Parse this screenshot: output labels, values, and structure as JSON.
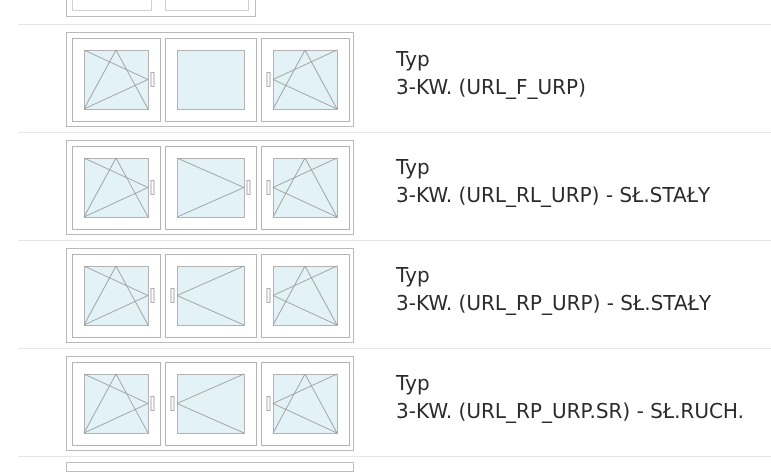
{
  "rows": [
    {
      "type_label": "Typ",
      "type_value": "3-KW. (URL_F_URP)",
      "panes": [
        "tilt-turn-right",
        "fixed",
        "tilt-turn-left"
      ]
    },
    {
      "type_label": "Typ",
      "type_value": "3-KW. (URL_RL_URP) - SŁ.STAŁY",
      "panes": [
        "tilt-turn-right",
        "turn-left",
        "tilt-turn-left"
      ]
    },
    {
      "type_label": "Typ",
      "type_value": "3-KW. (URL_RP_URP) - SŁ.STAŁY",
      "panes": [
        "tilt-turn-right",
        "turn-right",
        "tilt-turn-left"
      ]
    },
    {
      "type_label": "Typ",
      "type_value": "3-KW. (URL_RP_URP.SR) - SŁ.RUCH.",
      "panes": [
        "tilt-turn-right",
        "turn-right",
        "tilt-turn-left"
      ]
    }
  ],
  "colors": {
    "glass": "#e3f2f6",
    "frame": "#b3b3b3",
    "line": "#9a9a9a"
  }
}
